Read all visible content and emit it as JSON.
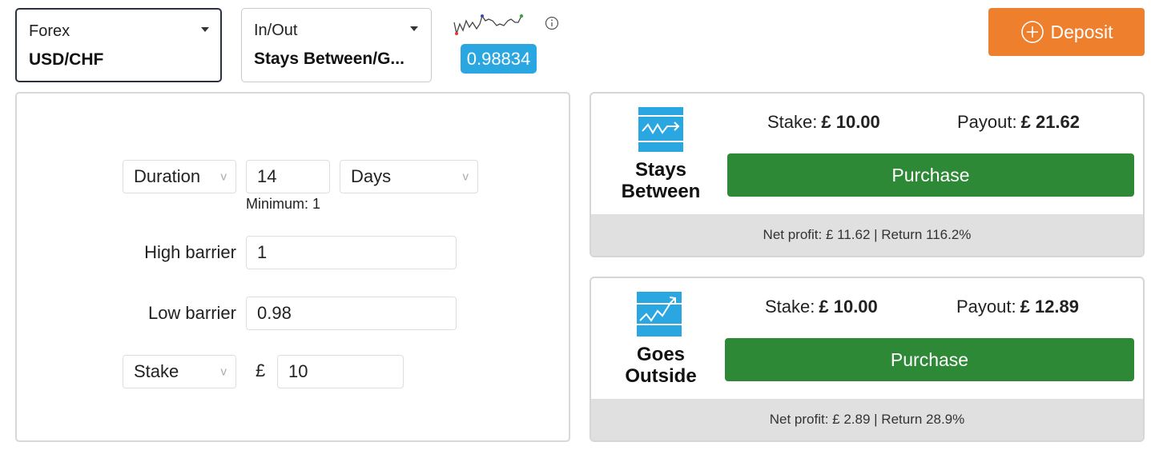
{
  "market": {
    "caption": "Forex",
    "value": "USD/CHF"
  },
  "trade_type": {
    "caption": "In/Out",
    "value": "Stays Between/G..."
  },
  "spot_price": "0.98834",
  "deposit": {
    "label": "Deposit"
  },
  "form": {
    "duration": {
      "type_label": "Duration",
      "amount": "14",
      "unit": "Days",
      "hint": "Minimum: 1"
    },
    "high_barrier": {
      "label": "High barrier",
      "value": "1"
    },
    "low_barrier": {
      "label": "Low barrier",
      "value": "0.98"
    },
    "stake": {
      "type_label": "Stake",
      "currency": "£",
      "value": "10"
    }
  },
  "contracts": [
    {
      "title_line1": "Stays",
      "title_line2": "Between",
      "stake_label": "Stake:",
      "stake_value": "£ 10.00",
      "payout_label": "Payout:",
      "payout_value": "£ 21.62",
      "button": "Purchase",
      "footer": "Net profit: £ 11.62 | Return 116.2%"
    },
    {
      "title_line1": "Goes",
      "title_line2": "Outside",
      "stake_label": "Stake:",
      "stake_value": "£ 10.00",
      "payout_label": "Payout:",
      "payout_value": "£ 12.89",
      "button": "Purchase",
      "footer": "Net profit: £ 2.89 | Return 28.9%"
    }
  ],
  "icons": {
    "dropdown": "caret-down-icon",
    "info": "info-icon",
    "deposit": "plus-circle-icon",
    "stays_between": "stays-between-icon",
    "goes_outside": "goes-outside-icon",
    "sparkline": "price-sparkline"
  },
  "colors": {
    "accent_blue": "#2aa7e1",
    "deposit_orange": "#ee7f2d",
    "purchase_green": "#2e8936",
    "footer_grey": "#e0e0e0"
  }
}
